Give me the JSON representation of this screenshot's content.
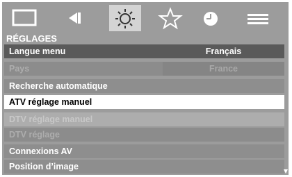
{
  "menu": {
    "tabs": [
      {
        "icon": "screen-icon"
      },
      {
        "icon": "speaker-icon"
      },
      {
        "icon": "settings-sun-icon"
      },
      {
        "icon": "star-icon"
      },
      {
        "icon": "clock-icon"
      },
      {
        "icon": "list-icon"
      }
    ],
    "section_title": "RÉGLAGES",
    "rows": [
      {
        "label": "Langue menu",
        "value": "Français"
      },
      {
        "label": "Pays",
        "value": "France"
      },
      {
        "label": "Recherche automatique"
      },
      {
        "label": "ATV réglage manuel"
      },
      {
        "label": "DTV réglage manuel"
      },
      {
        "label": "DTV réglage"
      },
      {
        "label": "Connexions AV"
      },
      {
        "label": "Position d’image"
      }
    ]
  }
}
